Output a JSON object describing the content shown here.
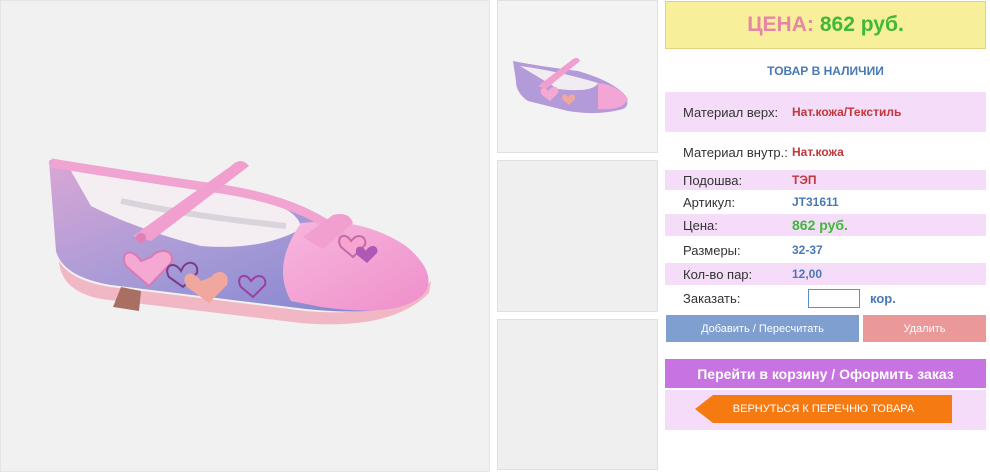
{
  "price_box": {
    "label": "ЦЕНА:",
    "value": "862 руб."
  },
  "stock_status": "ТОВАР В НАЛИЧИИ",
  "specs": [
    {
      "key": "Материал верх:",
      "value": "Нат.кожа/Текстиль"
    },
    {
      "key": "Материал внутр.:",
      "value": "Нат.кожа"
    },
    {
      "key": "Подошва:",
      "value": "ТЭП"
    },
    {
      "key": "Артикул:",
      "value": "JT31611"
    },
    {
      "key": "Цена:",
      "value": "862 руб."
    },
    {
      "key": "Размеры:",
      "value": "32-37"
    },
    {
      "key": "Кол-во пар:",
      "value": "12,00"
    }
  ],
  "order": {
    "label": "Заказать:",
    "input_value": "",
    "unit": "кор."
  },
  "buttons": {
    "recalc": "Добавить / Пересчитать",
    "delete": "Удалить",
    "cart": "Перейти в корзину / Оформить заказ",
    "back": "ВЕРНУТЬСЯ К ПЕРЕЧНЮ ТОВАРА"
  },
  "colors": {
    "accent_pink_row": "#f5dcf8",
    "price_bg": "#f8ef9b",
    "cart_button": "#c873e2",
    "back_button": "#f57a12",
    "recalc_button": "#7f9fd0",
    "delete_button": "#ea9898"
  }
}
